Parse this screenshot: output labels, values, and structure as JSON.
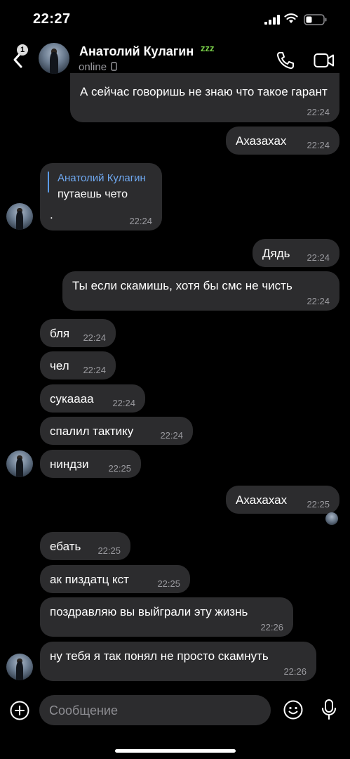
{
  "status_bar": {
    "time": "22:27"
  },
  "header": {
    "back_badge": "1",
    "contact_name": "Анатолий Кулагин",
    "status": "online",
    "name_emoji": "zzz"
  },
  "messages": [
    {
      "dir": "out",
      "text": "А сейчас говоришь не знаю что такое гарант",
      "time": "22:24"
    },
    {
      "dir": "out",
      "text": "Ахазахах",
      "time": "22:24"
    },
    {
      "dir": "in",
      "quote_author": "Анатолий Кулагин",
      "quote_text": "путаешь чето",
      "text": ".",
      "time": "22:24"
    },
    {
      "dir": "out",
      "text": "Дядь",
      "time": "22:24"
    },
    {
      "dir": "out",
      "text": "Ты если скамишь, хотя бы смс не чисть",
      "time": "22:24"
    },
    {
      "dir": "in",
      "text": "бля",
      "time": "22:24"
    },
    {
      "dir": "in",
      "text": "чел",
      "time": "22:24"
    },
    {
      "dir": "in",
      "text": "сукаааа",
      "time": "22:24"
    },
    {
      "dir": "in",
      "text": "спалил тактику",
      "time": "22:24"
    },
    {
      "dir": "in",
      "text": "ниндзи",
      "time": "22:25"
    },
    {
      "dir": "out",
      "text": "Ахахахах",
      "time": "22:25"
    },
    {
      "dir": "in",
      "text": "ебать",
      "time": "22:25"
    },
    {
      "dir": "in",
      "text": "ак пиздатц кст",
      "time": "22:25"
    },
    {
      "dir": "in",
      "text": "поздравляю вы выйграли эту жизнь",
      "time": "22:26"
    },
    {
      "dir": "in",
      "text": "ну тебя я так понял не просто скамнуть",
      "time": "22:26"
    }
  ],
  "composer": {
    "placeholder": "Сообщение"
  },
  "icons": {
    "back": "chevron-left-icon",
    "call": "phone-icon",
    "video": "video-camera-icon",
    "attach": "plus-circle-icon",
    "emoji": "smile-icon",
    "voice": "microphone-icon"
  },
  "colors": {
    "background": "#000000",
    "bubble": "#2c2c2e",
    "secondary_text": "#9a9a9f",
    "quote_accent": "#5b9be8",
    "quote_name": "#6fa8f0"
  }
}
